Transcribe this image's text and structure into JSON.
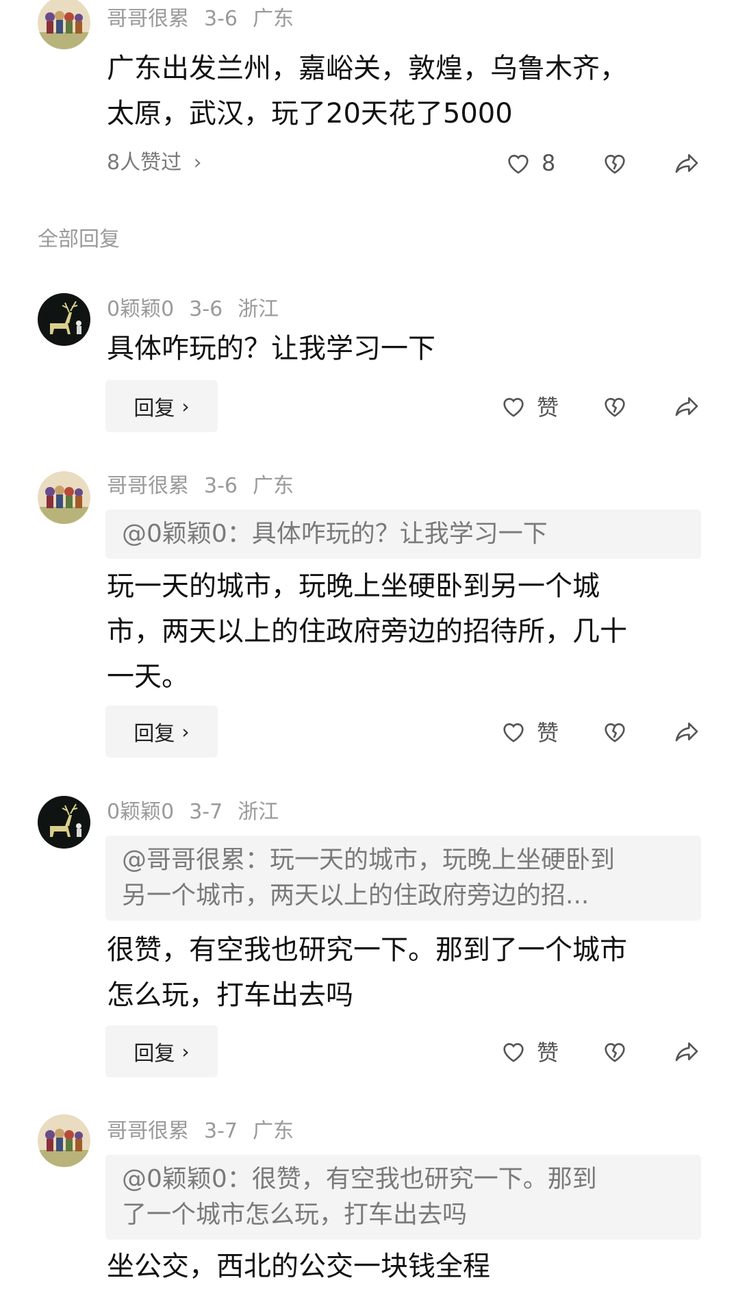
{
  "main_comment": {
    "user": "哥哥很累",
    "date": "3-6",
    "location": "广东",
    "text_line1": "广东出发兰州，嘉峪关，敦煌，乌鲁木齐，",
    "text_line2": "太原，武汉，玩了20天花了5000",
    "likes_link": "8人赞过",
    "like_count": "8",
    "avatar": "group-illustration-avatar"
  },
  "section_label": "全部回复",
  "replies": [
    {
      "user": "0颖颖0",
      "date": "3-6",
      "location": "浙江",
      "avatar": "deer-illustration-avatar",
      "quote": "",
      "text_lines": [
        "具体咋玩的？让我学习一下"
      ],
      "reply_label": "回复",
      "like_label": "赞"
    },
    {
      "user": "哥哥很累",
      "date": "3-6",
      "location": "广东",
      "avatar": "group-illustration-avatar",
      "quote_lines": [
        "@0颖颖0：具体咋玩的？让我学习一下"
      ],
      "text_lines": [
        "玩一天的城市，玩晚上坐硬卧到另一个城",
        "市，两天以上的住政府旁边的招待所，几十",
        "一天。"
      ],
      "reply_label": "回复",
      "like_label": "赞"
    },
    {
      "user": "0颖颖0",
      "date": "3-7",
      "location": "浙江",
      "avatar": "deer-illustration-avatar",
      "quote_lines": [
        "@哥哥很累：玩一天的城市，玩晚上坐硬卧到",
        "另一个城市，两天以上的住政府旁边的招..."
      ],
      "text_lines": [
        "很赞，有空我也研究一下。那到了一个城市",
        "怎么玩，打车出去吗"
      ],
      "reply_label": "回复",
      "like_label": "赞"
    },
    {
      "user": "哥哥很累",
      "date": "3-7",
      "location": "广东",
      "avatar": "group-illustration-avatar",
      "quote_lines": [
        "@0颖颖0：很赞，有空我也研究一下。那到",
        "了一个城市怎么玩，打车出去吗"
      ],
      "text_lines": [
        "坐公交，西北的公交一块钱全程"
      ]
    }
  ],
  "icons": {
    "like": "heart-outline-icon",
    "dislike": "broken-heart-icon",
    "share": "share-arrow-icon",
    "chevron": "chevron-right-icon"
  },
  "colors": {
    "meta_text": "#9a9a9a",
    "quote_bg": "#f4f4f4",
    "body_text": "#111111"
  }
}
